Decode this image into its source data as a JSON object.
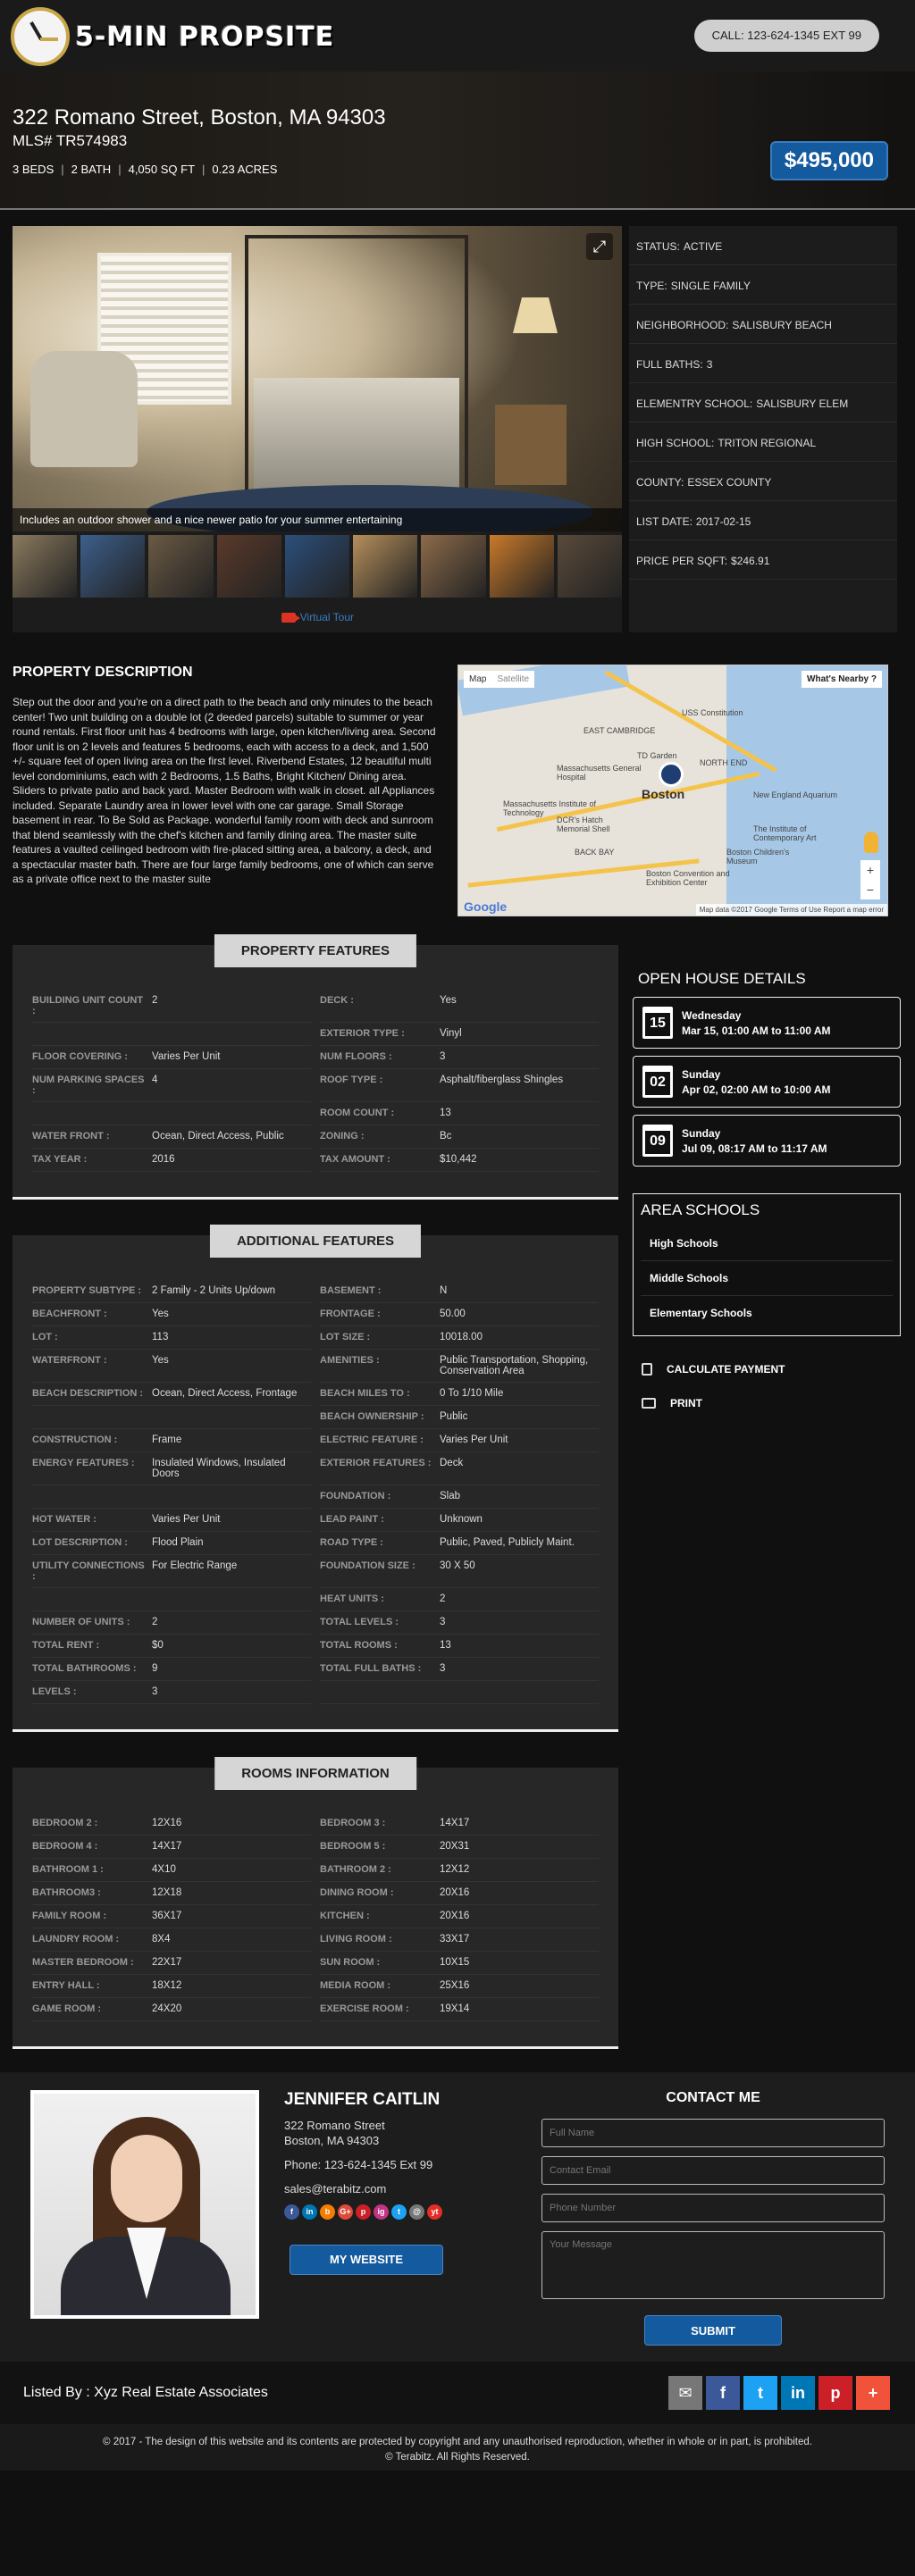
{
  "header": {
    "logo_text": "5-MIN PROPSITE",
    "call_label": "CALL: 123-624-1345 EXT 99"
  },
  "hero": {
    "address": "322 Romano Street, Boston, MA 94303",
    "mls": "MLS# TR574983",
    "specs": [
      "3 BEDS",
      "2 BATH",
      "4,050 SQ FT",
      "0.23 ACRES"
    ],
    "price": "$495,000"
  },
  "gallery": {
    "caption": "Includes an outdoor shower and a nice newer patio for your summer entertaining",
    "thumb_colors": [
      "#8b7a5e",
      "#3d5f8c",
      "#6b5a44",
      "#5a3a2a",
      "#2c4f7c",
      "#b58f5c",
      "#8c6b4a",
      "#c97a2a",
      "#5a4a3a"
    ],
    "virtual_tour_label": "Virtual Tour"
  },
  "status": [
    {
      "label": "STATUS:",
      "value": "ACTIVE"
    },
    {
      "label": "TYPE:",
      "value": "SINGLE FAMILY"
    },
    {
      "label": "NEIGHBORHOOD:",
      "value": "SALISBURY BEACH"
    },
    {
      "label": "FULL BATHS:",
      "value": "3"
    },
    {
      "label": "ELEMENTRY SCHOOL:",
      "value": "SALISBURY ELEM"
    },
    {
      "label": "HIGH SCHOOL:",
      "value": "TRITON REGIONAL"
    },
    {
      "label": "COUNTY:",
      "value": "ESSEX COUNTY"
    },
    {
      "label": "LIST DATE:",
      "value": "2017-02-15"
    },
    {
      "label": "PRICE PER SQFT:",
      "value": "$246.91"
    }
  ],
  "description": {
    "title": "PROPERTY DESCRIPTION",
    "text": "Step out the door and you're on a direct path to the beach and only minutes to the beach center! Two unit building on a double lot (2 deeded parcels) suitable to summer or year round rentals. First floor unit has 4 bedrooms with large, open kitchen/living area. Second floor unit is on 2 levels and features 5 bedrooms, each with access to a deck, and 1,500 +/- square feet of open living area on the first level. Riverbend Estates, 12 beautiful multi level condominiums, each with 2 Bedrooms, 1.5 Baths, Bright Kitchen/ Dining area. Sliders to private patio and back yard. Master Bedroom with walk in closet. all Appliances included. Separate Laundry area in lower level with one car garage. Small Storage basement in rear. To Be Sold as Package. wonderful family room with deck and sunroom that blend seamlessly with the chef's kitchen and family dining area. The master suite features a vaulted ceilinged bedroom with fire-placed sitting area, a balcony, a deck, and a spectacular master bath. There are four large family bedrooms, one of which can serve as a private office next to the master suite"
  },
  "map": {
    "map_tab": "Map",
    "satellite_tab": "Satellite",
    "nearby": "What's Nearby ?",
    "city_label": "Boston",
    "places": [
      "EAST CAMBRIDGE",
      "Massachusetts General Hospital",
      "Massachusetts Institute of Technology",
      "DCR's Hatch Memorial Shell",
      "BACK BAY",
      "New England Aquarium",
      "The Institute of Contemporary Art",
      "Boston Children's Museum",
      "Boston Convention and Exhibition Center",
      "USS Constitution",
      "TD Garden",
      "NORTH END"
    ],
    "footer": "Map data ©2017 Google   Terms of Use   Report a map error",
    "google": "Google"
  },
  "property_features": {
    "title": "PROPERTY FEATURES",
    "rows": [
      {
        "k": "BUILDING UNIT COUNT :",
        "v": "2",
        "k2": "DECK :",
        "v2": "Yes"
      },
      {
        "k": "",
        "v": "",
        "k2": "EXTERIOR TYPE :",
        "v2": "Vinyl"
      },
      {
        "k": "FLOOR COVERING :",
        "v": "Varies Per Unit",
        "k2": "NUM FLOORS :",
        "v2": "3"
      },
      {
        "k": "NUM PARKING SPACES :",
        "v": "4",
        "k2": "ROOF TYPE :",
        "v2": "Asphalt/fiberglass Shingles"
      },
      {
        "k": "",
        "v": "",
        "k2": "ROOM COUNT :",
        "v2": "13"
      },
      {
        "k": "WATER FRONT :",
        "v": "Ocean, Direct Access, Public",
        "k2": "ZONING :",
        "v2": "Bc"
      },
      {
        "k": "TAX YEAR :",
        "v": "2016",
        "k2": "TAX AMOUNT :",
        "v2": "$10,442"
      }
    ]
  },
  "additional_features": {
    "title": "ADDITIONAL FEATURES",
    "rows": [
      {
        "k": "PROPERTY SUBTYPE :",
        "v": "2 Family - 2 Units Up/down",
        "k2": "BASEMENT :",
        "v2": "N"
      },
      {
        "k": "BEACHFRONT :",
        "v": "Yes",
        "k2": "FRONTAGE :",
        "v2": "50.00"
      },
      {
        "k": "LOT :",
        "v": "113",
        "k2": "LOT SIZE :",
        "v2": "10018.00"
      },
      {
        "k": "WATERFRONT :",
        "v": "Yes",
        "k2": "AMENITIES :",
        "v2": "Public Transportation, Shopping, Conservation Area"
      },
      {
        "k": "BEACH DESCRIPTION :",
        "v": "Ocean, Direct Access, Frontage",
        "k2": "BEACH MILES TO :",
        "v2": "0 To 1/10 Mile"
      },
      {
        "k": "",
        "v": "",
        "k2": "BEACH OWNERSHIP :",
        "v2": "Public"
      },
      {
        "k": "CONSTRUCTION :",
        "v": "Frame",
        "k2": "ELECTRIC FEATURE :",
        "v2": "Varies Per Unit"
      },
      {
        "k": "ENERGY FEATURES :",
        "v": "Insulated Windows, Insulated Doors",
        "k2": "EXTERIOR FEATURES :",
        "v2": "Deck"
      },
      {
        "k": "",
        "v": "",
        "k2": "FOUNDATION :",
        "v2": "Slab"
      },
      {
        "k": "HOT WATER :",
        "v": "Varies Per Unit",
        "k2": "LEAD PAINT :",
        "v2": "Unknown"
      },
      {
        "k": "LOT DESCRIPTION :",
        "v": "Flood Plain",
        "k2": "ROAD TYPE :",
        "v2": "Public, Paved, Publicly Maint."
      },
      {
        "k": "UTILITY CONNECTIONS :",
        "v": "For Electric Range",
        "k2": "FOUNDATION SIZE :",
        "v2": "30 X 50"
      },
      {
        "k": "",
        "v": "",
        "k2": "HEAT UNITS :",
        "v2": "2"
      },
      {
        "k": "NUMBER OF UNITS :",
        "v": "2",
        "k2": "TOTAL LEVELS :",
        "v2": "3"
      },
      {
        "k": "TOTAL RENT :",
        "v": "$0",
        "k2": "TOTAL ROOMS :",
        "v2": "13"
      },
      {
        "k": "TOTAL BATHROOMS :",
        "v": "9",
        "k2": "TOTAL FULL BATHS :",
        "v2": "3"
      },
      {
        "k": "LEVELS :",
        "v": "3",
        "k2": "",
        "v2": ""
      }
    ]
  },
  "rooms": {
    "title": "ROOMS INFORMATION",
    "rows": [
      {
        "k": "BEDROOM 2 :",
        "v": "12X16",
        "k2": "BEDROOM 3 :",
        "v2": "14X17"
      },
      {
        "k": "BEDROOM 4 :",
        "v": "14X17",
        "k2": "BEDROOM 5 :",
        "v2": "20X31"
      },
      {
        "k": "BATHROOM 1 :",
        "v": "4X10",
        "k2": "BATHROOM 2 :",
        "v2": "12X12"
      },
      {
        "k": "BATHROOM3 :",
        "v": "12X18",
        "k2": "DINING ROOM :",
        "v2": "20X16"
      },
      {
        "k": "FAMILY ROOM :",
        "v": "36X17",
        "k2": "KITCHEN :",
        "v2": "20X16"
      },
      {
        "k": "LAUNDRY ROOM :",
        "v": "8X4",
        "k2": "LIVING ROOM :",
        "v2": "33X17"
      },
      {
        "k": "MASTER BEDROOM :",
        "v": "22X17",
        "k2": "SUN ROOM :",
        "v2": "10X15"
      },
      {
        "k": "ENTRY HALL :",
        "v": "18X12",
        "k2": "MEDIA ROOM :",
        "v2": "25X16"
      },
      {
        "k": "GAME ROOM :",
        "v": "24X20",
        "k2": "EXERCISE ROOM :",
        "v2": "19X14"
      }
    ]
  },
  "open_house": {
    "title": "OPEN HOUSE DETAILS",
    "items": [
      {
        "date_num": "15",
        "day": "Wednesday",
        "time": "Mar 15, 01:00 AM to 11:00 AM"
      },
      {
        "date_num": "02",
        "day": "Sunday",
        "time": "Apr 02, 02:00 AM to 10:00 AM"
      },
      {
        "date_num": "09",
        "day": "Sunday",
        "time": "Jul 09, 08:17 AM to 11:17 AM"
      }
    ]
  },
  "schools": {
    "title": "AREA SCHOOLS",
    "items": [
      "High Schools",
      "Middle Schools",
      "Elementary Schools"
    ]
  },
  "side_links": {
    "calculate": "CALCULATE PAYMENT",
    "print": "PRINT"
  },
  "agent": {
    "name": "JENNIFER CAITLIN",
    "street": "322 Romano Street",
    "city": "Boston, MA 94303",
    "phone": "Phone: 123-624-1345 Ext 99",
    "email": "sales@terabitz.com",
    "socials": [
      {
        "label": "f",
        "color": "#3b5998"
      },
      {
        "label": "in",
        "color": "#0077b5"
      },
      {
        "label": "b",
        "color": "#f57d00"
      },
      {
        "label": "G+",
        "color": "#dd4b39"
      },
      {
        "label": "p",
        "color": "#cb2027"
      },
      {
        "label": "ig",
        "color": "#c13584"
      },
      {
        "label": "t",
        "color": "#1da1f2"
      },
      {
        "label": "@",
        "color": "#777777"
      },
      {
        "label": "yt",
        "color": "#e52d27"
      }
    ],
    "website_label": "MY WEBSITE"
  },
  "contact": {
    "title": "CONTACT ME",
    "name_placeholder": "Full Name",
    "email_placeholder": "Contact Email",
    "phone_placeholder": "Phone Number",
    "message_placeholder": "Your Message",
    "submit_label": "SUBMIT"
  },
  "footer": {
    "listed_by": "Listed By : Xyz Real Estate Associates",
    "share": [
      {
        "label": "✉",
        "color": "#777777"
      },
      {
        "label": "f",
        "color": "#3b5998"
      },
      {
        "label": "t",
        "color": "#1da1f2"
      },
      {
        "label": "in",
        "color": "#0077b5"
      },
      {
        "label": "p",
        "color": "#cb2027"
      },
      {
        "label": "+",
        "color": "#f0533a"
      }
    ],
    "copyright_line1": "© 2017 - The design of this website and its contents are protected by copyright and any unauthorised reproduction, whether in whole or in part, is prohibited.",
    "copyright_line2": "© Terabitz. All Rights Reserved."
  }
}
